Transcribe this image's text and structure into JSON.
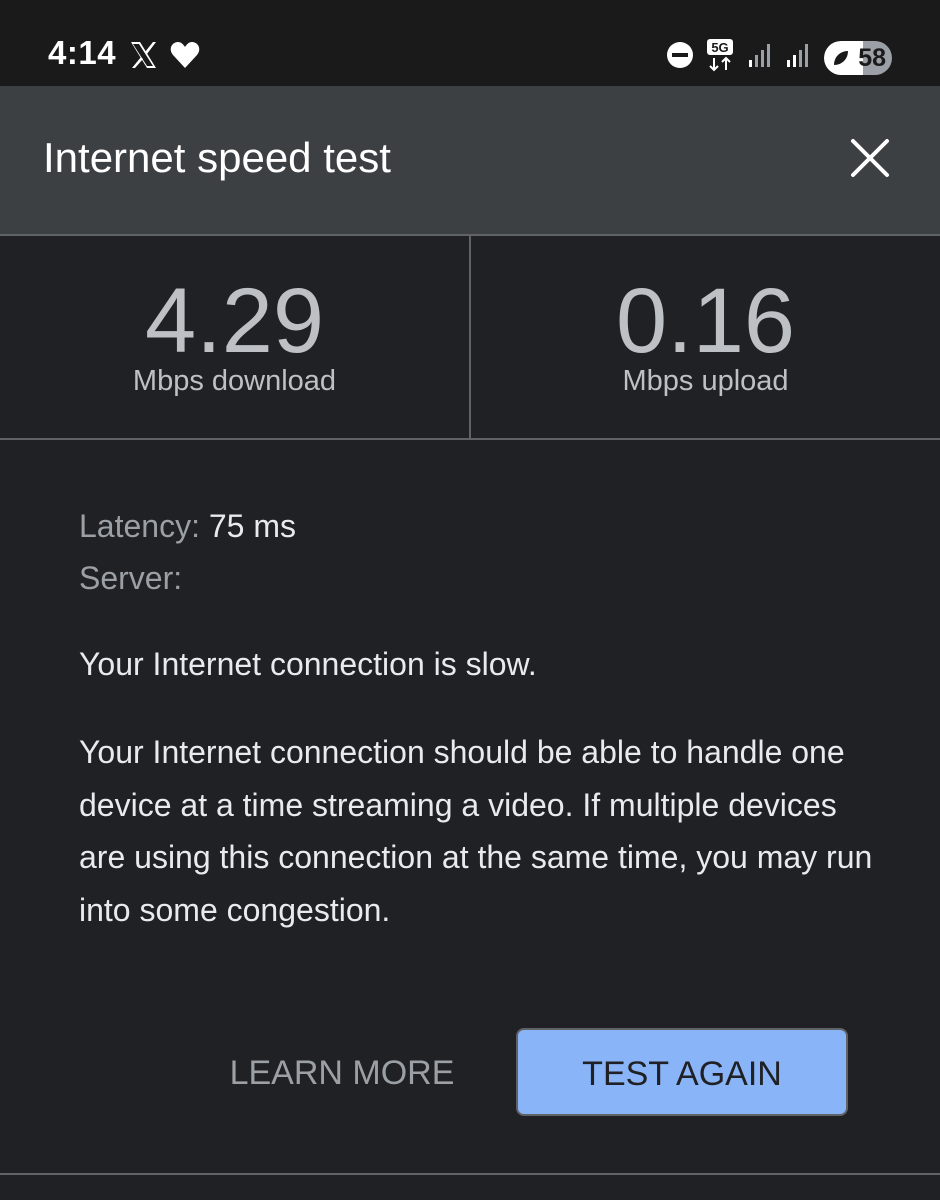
{
  "status_bar": {
    "time": "4:14",
    "left_icons": [
      "x-logo-icon",
      "heart-icon"
    ],
    "right_icons": [
      "do-not-disturb-icon",
      "5g-icon",
      "signal-icon",
      "signal-icon"
    ],
    "network_label": "5G",
    "battery_level": "58",
    "battery_fraction": 0.58
  },
  "dialog": {
    "title": "Internet speed test",
    "download": {
      "value": "4.29",
      "label": "Mbps download"
    },
    "upload": {
      "value": "0.16",
      "label": "Mbps upload"
    },
    "latency_label": "Latency:",
    "latency_value": "75 ms",
    "server_label": "Server:",
    "server_value": "",
    "summary": "Your Internet connection is slow.",
    "description": "Your Internet connection should be able to handle one device at a time streaming a video. If multiple devices are using this connection at the same time, you may run into some congestion.",
    "learn_more_label": "LEARN MORE",
    "test_again_label": "TEST AGAIN"
  },
  "colors": {
    "background": "#202124",
    "header": "#3c4043",
    "accent_button": "#8ab4f8",
    "status_bar": "#1a1a1a"
  }
}
